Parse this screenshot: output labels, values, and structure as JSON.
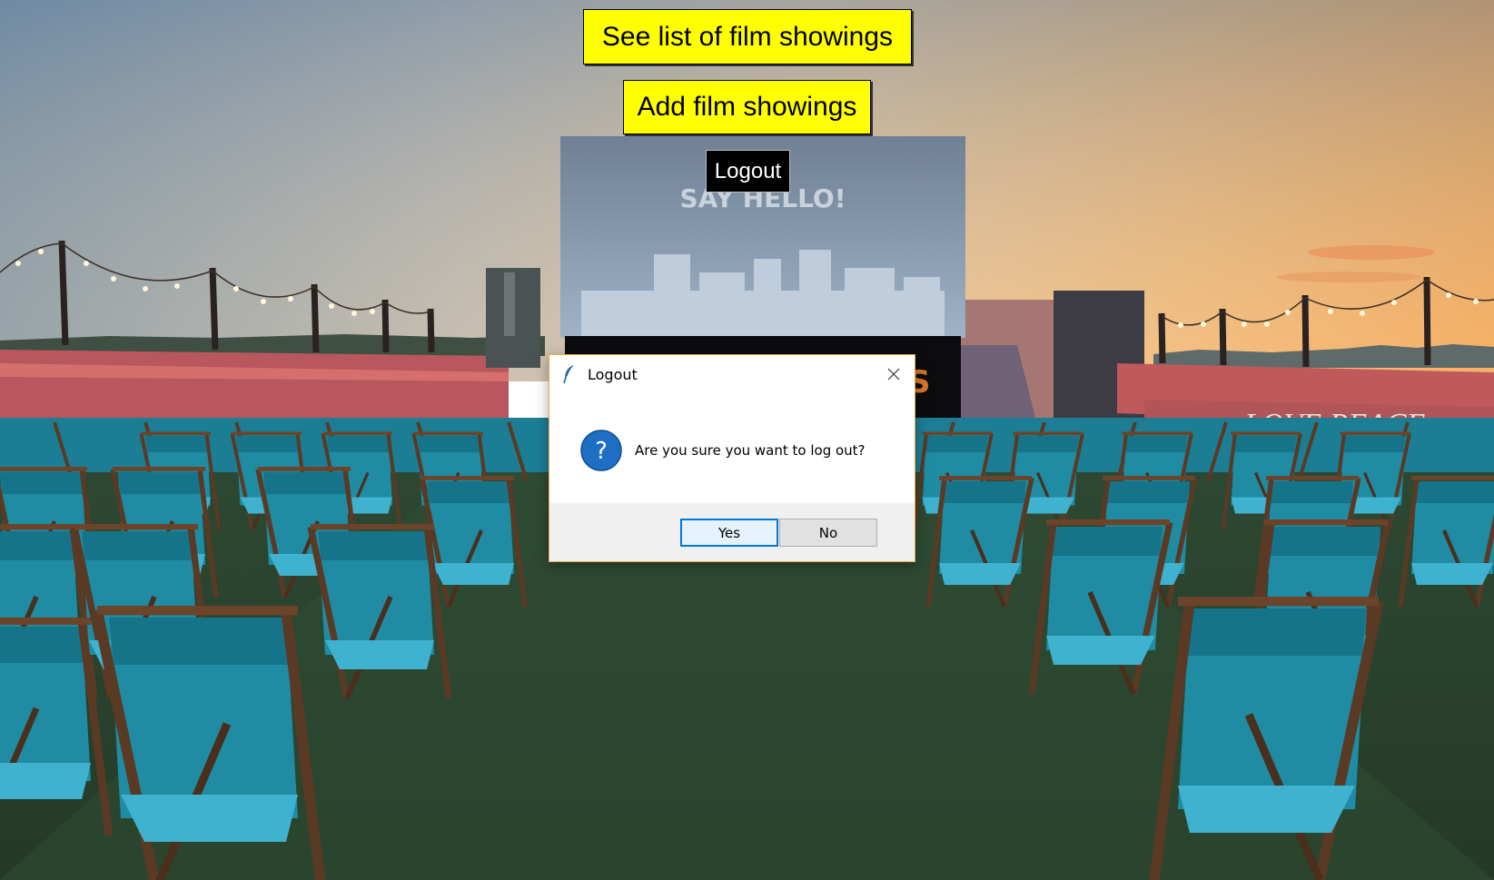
{
  "main": {
    "see_list_label": "See list of film showings",
    "add_label": "Add film showings",
    "logout_label": "Logout",
    "accent_yellow": "#ffff00"
  },
  "background": {
    "screen_text": "SAY HELLO!",
    "wall_text": "LOVE PEACE"
  },
  "dialog": {
    "title": "Logout",
    "message": "Are you sure you want to log out?",
    "icon": "question-icon",
    "title_icon": "feather-icon",
    "yes_label": "Yes",
    "no_label": "No",
    "accent": "#0078d7"
  }
}
